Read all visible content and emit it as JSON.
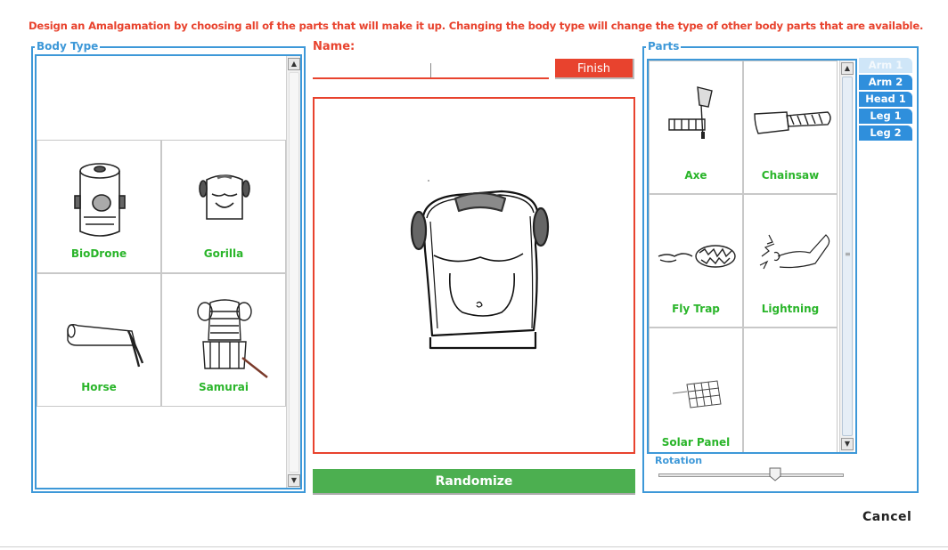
{
  "instructions": "Design an Amalgamation by choosing all of the parts that will make it up. Changing the body type will change the type of other body parts that are available.",
  "body_type": {
    "legend": "Body Type",
    "items": [
      {
        "label": "BioDrone",
        "icon": "biodrone-icon"
      },
      {
        "label": "Gorilla",
        "icon": "gorilla-icon"
      },
      {
        "label": "Horse",
        "icon": "horse-icon"
      },
      {
        "label": "Samurai",
        "icon": "samurai-icon"
      }
    ]
  },
  "name": {
    "label": "Name:",
    "value": ""
  },
  "finish_label": "Finish",
  "randomize_label": "Randomize",
  "parts": {
    "legend": "Parts",
    "items": [
      {
        "label": "Axe",
        "icon": "axe-icon"
      },
      {
        "label": "Chainsaw",
        "icon": "chainsaw-icon"
      },
      {
        "label": "Fly Trap",
        "icon": "fly-trap-icon"
      },
      {
        "label": "Lightning",
        "icon": "lightning-icon"
      },
      {
        "label": "Solar Panel",
        "icon": "solar-panel-icon"
      }
    ],
    "tabs": [
      {
        "label": "Arm 1",
        "active": true
      },
      {
        "label": "Arm 2",
        "active": false
      },
      {
        "label": "Head 1",
        "active": false
      },
      {
        "label": "Leg 1",
        "active": false
      },
      {
        "label": "Leg 2",
        "active": false
      }
    ],
    "rotation_label": "Rotation",
    "rotation_value": 0.63
  },
  "cancel_label": "Cancel",
  "colors": {
    "accent_red": "#e8432e",
    "accent_blue": "#3d98d8",
    "label_green": "#2ab52a",
    "randomize_green": "#4caf50"
  }
}
